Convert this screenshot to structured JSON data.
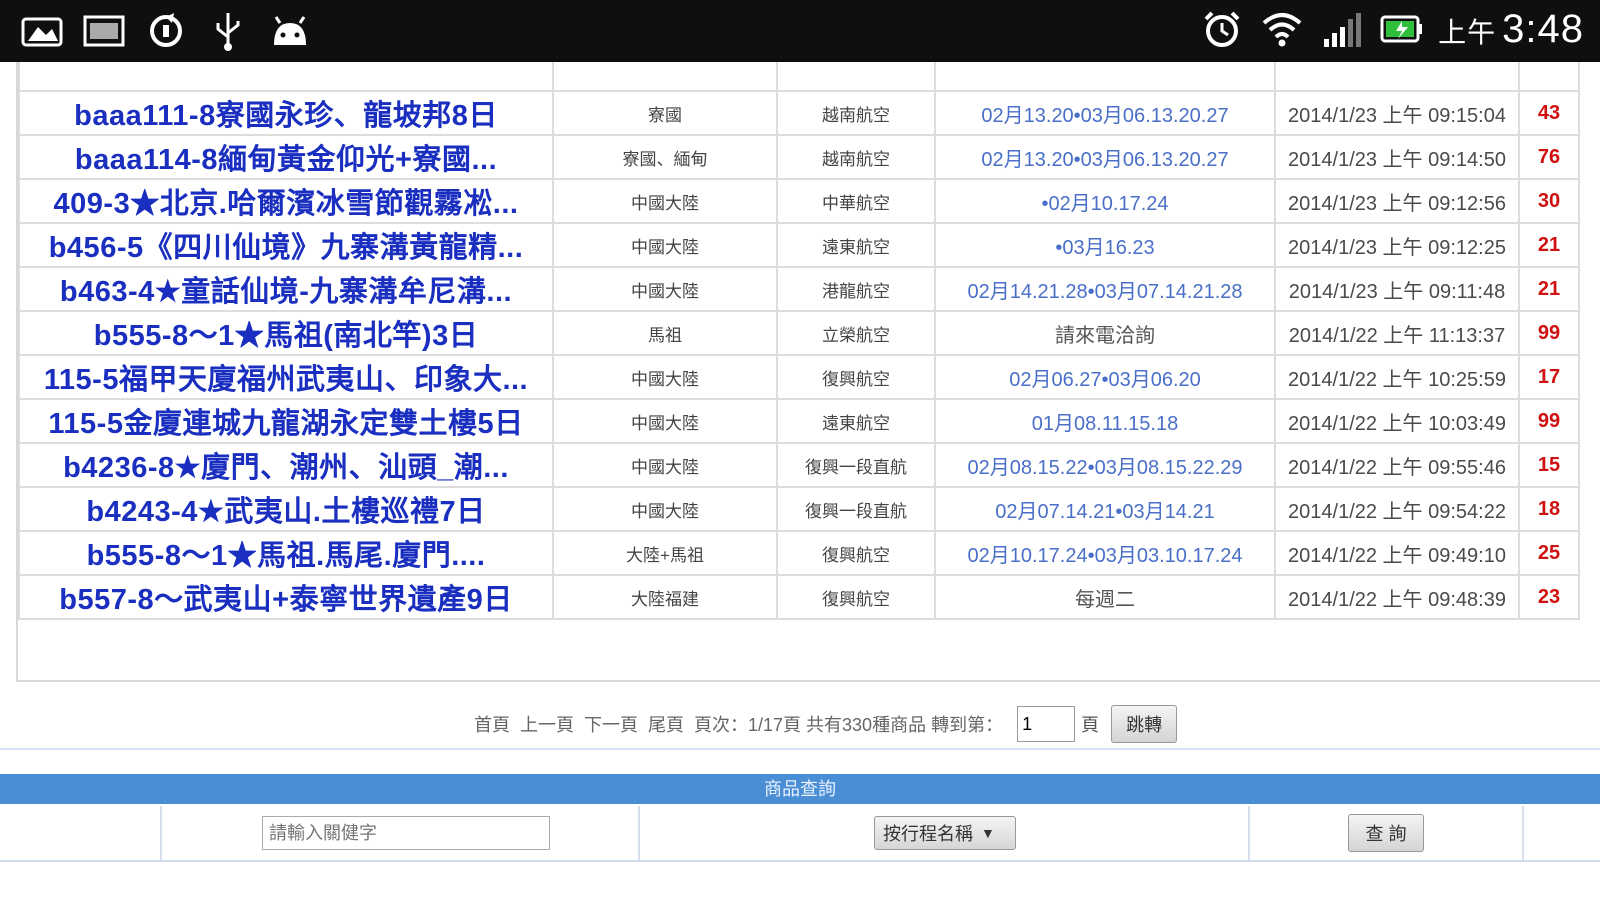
{
  "status_bar": {
    "left_icons": [
      "picture-icon",
      "keyboard-icon",
      "sync-icon",
      "usb-icon",
      "android-icon"
    ],
    "right_icons": [
      "alarm-icon",
      "wifi-icon",
      "signal-icon",
      "battery-icon"
    ],
    "ampm": "上午",
    "time": "3:48"
  },
  "table": {
    "ghost_row": {
      "name": "",
      "area": "",
      "airline": "",
      "dates": "",
      "time": "",
      "price": ""
    },
    "rows": [
      {
        "name": "baaa111-8寮國永珍、龍坡邦8日",
        "area": "寮國",
        "airline": "越南航空",
        "dates": "02月13.20•03月06.13.20.27",
        "time": "2014/1/23 上午 09:15:04",
        "price": "43"
      },
      {
        "name": "baaa114-8緬甸黃金仰光+寮國...",
        "area": "寮國、緬甸",
        "airline": "越南航空",
        "dates": "02月13.20•03月06.13.20.27",
        "time": "2014/1/23 上午 09:14:50",
        "price": "76"
      },
      {
        "name": "409-3★北京.哈爾濱冰雪節觀霧凇...",
        "area": "中國大陸",
        "airline": "中華航空",
        "dates": "•02月10.17.24",
        "time": "2014/1/23 上午 09:12:56",
        "price": "30"
      },
      {
        "name": "b456-5《四川仙境》九寨溝黃龍精...",
        "area": "中國大陸",
        "airline": "遠東航空",
        "dates": "•03月16.23",
        "time": "2014/1/23 上午 09:12:25",
        "price": "21"
      },
      {
        "name": "b463-4★童話仙境-九寨溝牟尼溝...",
        "area": "中國大陸",
        "airline": "港龍航空",
        "dates": "02月14.21.28•03月07.14.21.28",
        "time": "2014/1/23 上午 09:11:48",
        "price": "21"
      },
      {
        "name": "b555-8～1★馬祖(南北竿)3日",
        "area": "馬祖",
        "airline": "立榮航空",
        "dates": "請來電洽詢",
        "time": "2014/1/22 上午 11:13:37",
        "price": "99"
      },
      {
        "name": "115-5福甲天廈福州武夷山、印象大...",
        "area": "中國大陸",
        "airline": "復興航空",
        "dates": "02月06.27•03月06.20",
        "time": "2014/1/22 上午 10:25:59",
        "price": "17"
      },
      {
        "name": "115-5金廈連城九龍湖永定雙土樓5日",
        "area": "中國大陸",
        "airline": "遠東航空",
        "dates": "01月08.11.15.18",
        "time": "2014/1/22 上午 10:03:49",
        "price": "99"
      },
      {
        "name": "b4236-8★廈門、潮州、汕頭_潮...",
        "area": "中國大陸",
        "airline": "復興一段直航",
        "dates": "02月08.15.22•03月08.15.22.29",
        "time": "2014/1/22 上午 09:55:46",
        "price": "15"
      },
      {
        "name": "b4243-4★武夷山.土樓巡禮7日",
        "area": "中國大陸",
        "airline": "復興一段直航",
        "dates": "02月07.14.21•03月14.21",
        "time": "2014/1/22 上午 09:54:22",
        "price": "18"
      },
      {
        "name": "b555-8～1★馬祖.馬尾.廈門....",
        "area": "大陸+馬祖",
        "airline": "復興航空",
        "dates": "02月10.17.24•03月03.10.17.24",
        "time": "2014/1/22 上午 09:49:10",
        "price": "25"
      },
      {
        "name": "b557-8～武夷山+泰寧世界遺產9日",
        "area": "大陸福建",
        "airline": "復興航空",
        "dates": "每週二",
        "time": "2014/1/22 上午 09:48:39",
        "price": "23"
      }
    ]
  },
  "pager": {
    "first": "首頁",
    "prev": "上一頁",
    "next": "下一頁",
    "last": "尾頁",
    "info": "頁次：1/17頁 共有330種商品 轉到第：",
    "page_value": "1",
    "page_suffix": "頁",
    "go_label": "跳轉"
  },
  "search": {
    "header": "商品查詢",
    "keyword_placeholder": "請輸入關健字",
    "field_select": "按行程名稱",
    "submit_label": "查 詢"
  },
  "colors": {
    "link_blue": "#1a2fc0",
    "date_blue": "#4a6fc8",
    "price_red": "#d01010",
    "search_header_bg": "#4a8fd6"
  }
}
